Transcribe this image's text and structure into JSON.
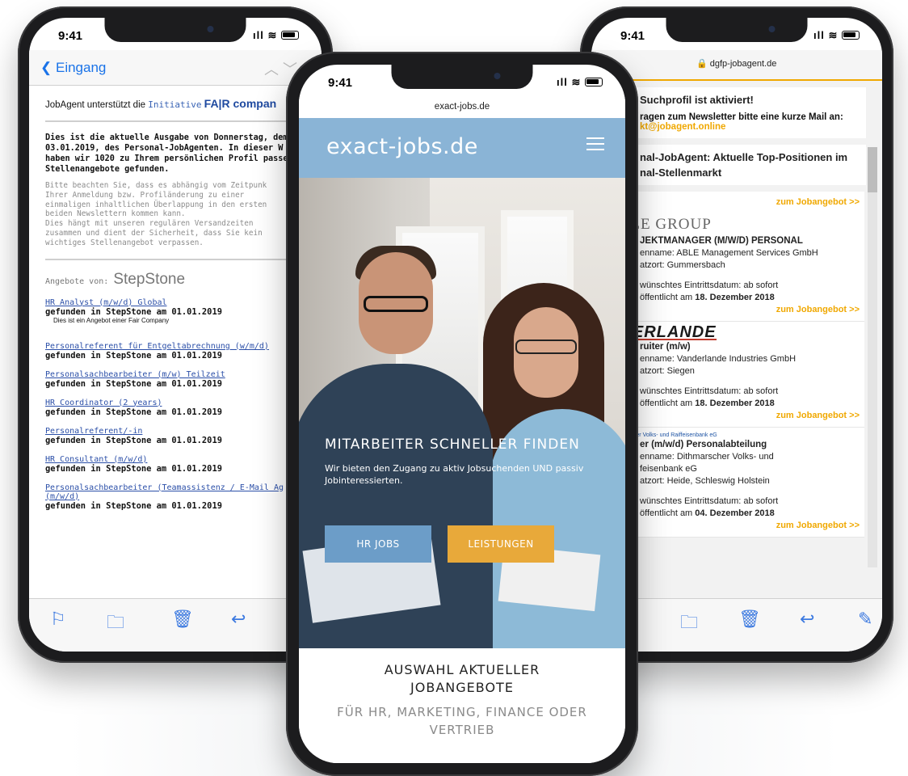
{
  "status_time": "9:41",
  "left_phone": {
    "back_label": "Eingang",
    "intro_text": "JobAgent unterstützt die",
    "intro_initiative": "Initiative",
    "intro_brand": "FA|R compan",
    "lead_lines": [
      "Dies ist die aktuelle Ausgabe von Donnerstag, dem",
      "03.01.2019, des Personal-JobAgenten. In dieser W",
      "haben wir 1020 zu Ihrem persönlichen Profil passe",
      "Stellenangebote gefunden."
    ],
    "note_lines": [
      "Bitte beachten Sie, dass es abhängig vom Zeitpunk",
      "Ihrer Anmeldung bzw. Profiländerung zu einer",
      "einmaligen inhaltlichen Überlappung in den ersten",
      "beiden Newslettern kommen kann.",
      "Dies hängt mit unseren regulären Versandzeiten",
      "zusammen und dient der Sicherheit, dass Sie kein",
      "wichtiges Stellenangebot verpassen."
    ],
    "offers_label": "Angebote von:",
    "offers_brand": "StepStone",
    "jobs": [
      {
        "title": "HR Analyst (m/w/d) Global",
        "found": "gefunden in StepStone am 01.01.2019",
        "sub": "Dies ist ein Angebot einer Fair Company"
      },
      {
        "title": "Personalreferent für Entgeltabrechnung (w/m/d)",
        "found": "gefunden in StepStone am 01.01.2019"
      },
      {
        "title": "Personalsachbearbeiter (m/w) Teilzeit",
        "found": "gefunden in StepStone am 01.01.2019"
      },
      {
        "title": "HR Coordinator (2 years)",
        "found": "gefunden in StepStone am 01.01.2019"
      },
      {
        "title": "Personalreferent/-in",
        "found": "gefunden in StepStone am 01.01.2019"
      },
      {
        "title": "HR Consultant (m/w/d)",
        "found": "gefunden in StepStone am 01.01.2019"
      },
      {
        "title": "Personalsachbearbeiter (Teamassistenz / E-Mail Ag",
        "title2": "(m/w/d)",
        "found": "gefunden in StepStone am 01.01.2019"
      }
    ]
  },
  "center_phone": {
    "url": "exact-jobs.de",
    "logo": "exact-jobs.de",
    "hero_title": "MITARBEITER SCHNELLER FINDEN",
    "hero_sub": "Wir bieten den Zugang zu aktiv Jobsuchenden UND passiv Jobinteressierten.",
    "btn_hr": "HR JOBS",
    "btn_leistungen": "LEISTUNGEN",
    "section_title": "AUSWAHL AKTUELLER JOBANGEBOTE",
    "section_sub": "FÜR HR, MARKETING, FINANCE ODER VERTRIEB"
  },
  "right_phone": {
    "url": "dgfp-jobagent.de",
    "activated": "Suchprofil ist aktiviert!",
    "newsletter_q": "ragen zum Newsletter bitte eine kurze Mail an:",
    "newsletter_mail": "kt@jobagent.online",
    "section_h": "nal-JobAgent: Aktuelle Top-Positionen im",
    "section_h2": "nal-Stellenmarkt",
    "cta": "zum Jobangebot >>",
    "cards": [
      {
        "logo": "ABLE GROUP",
        "title": "JEKTMANAGER (M/W/D) PERSONAL",
        "company": "enname: ABLE Management Services GmbH",
        "place": "atzort: Gummersbach",
        "start": "wünschtes Eintrittsdatum: ab sofort",
        "published": "öffentlicht am",
        "date": "18. Dezember 2018"
      },
      {
        "logo": "NDERLANDE",
        "title": "ruiter (m/w)",
        "company": "enname: Vanderlande Industries GmbH",
        "place": "atzort: Siegen",
        "start": "wünschtes Eintrittsdatum: ab sofort",
        "published": "öffentlicht am",
        "date": "18. Dezember 2018"
      },
      {
        "logo": "Dithmarscher Volks- und Raiffeisenbank eG",
        "title": "er (m/w/d) Personalabteilung",
        "company": "enname: Dithmarscher Volks- und",
        "company2": "feisenbank eG",
        "place": "atzort: Heide, Schleswig Holstein",
        "start": "wünschtes Eintrittsdatum: ab sofort",
        "published": "öffentlicht am",
        "date": "04. Dezember 2018"
      }
    ]
  }
}
